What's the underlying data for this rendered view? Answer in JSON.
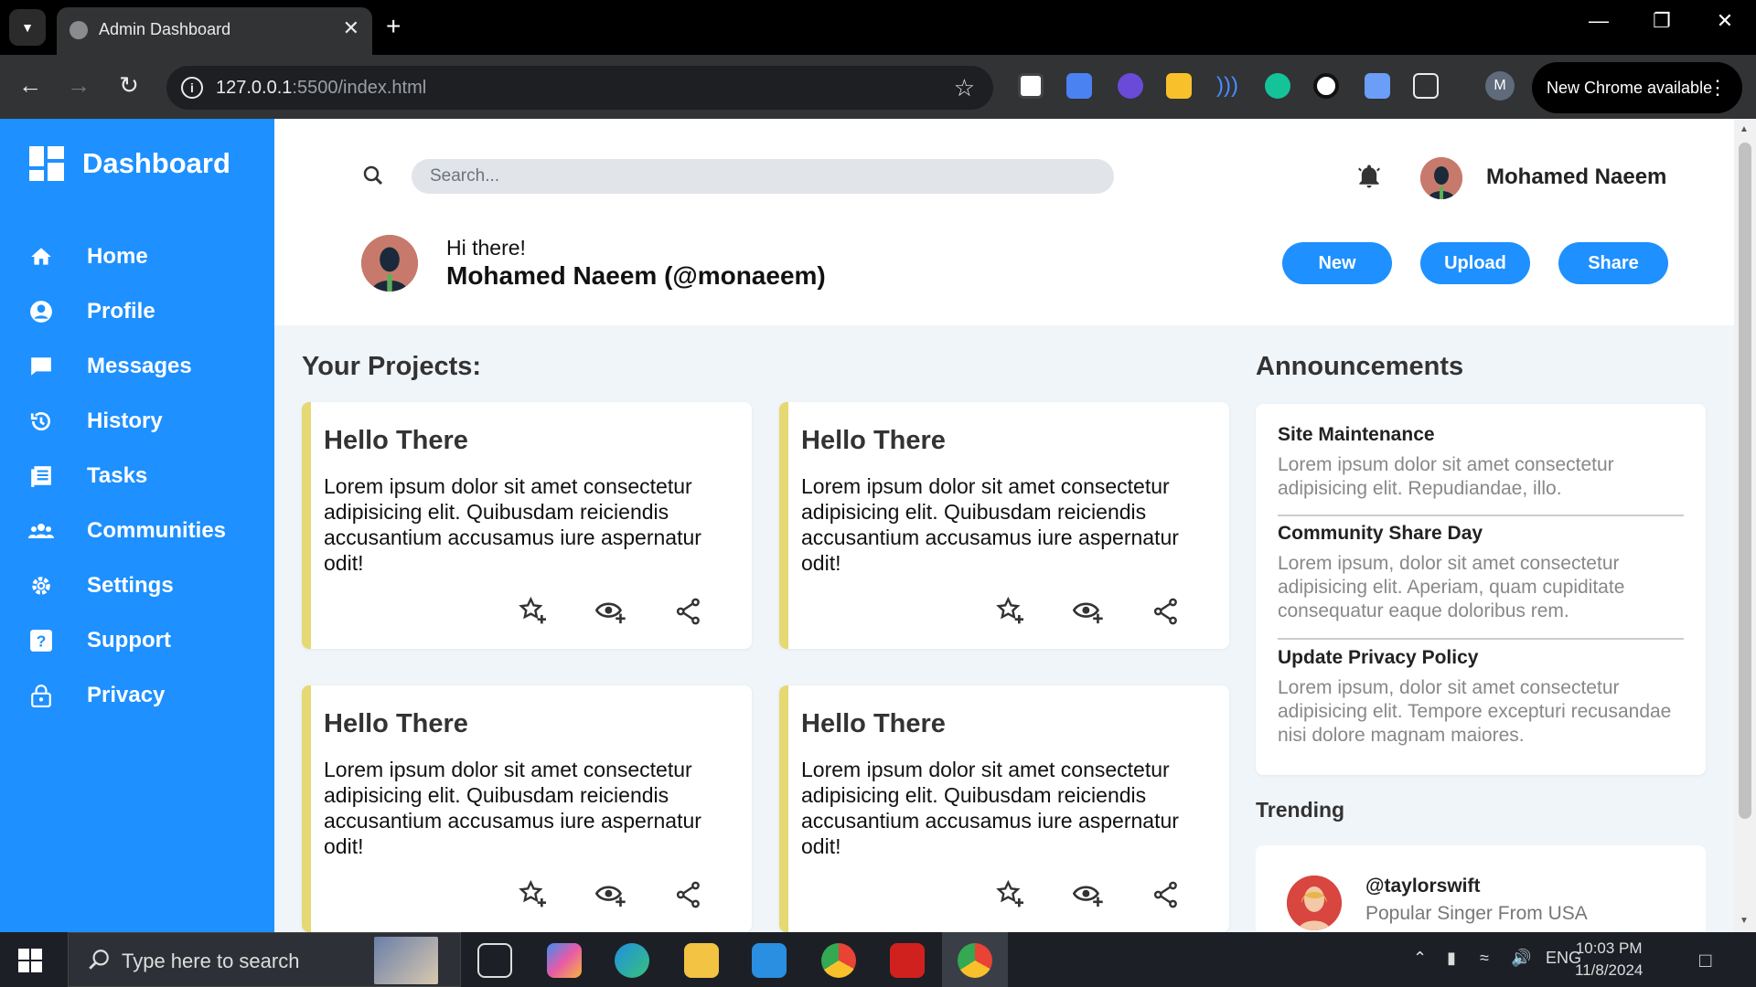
{
  "browser": {
    "tab_title": "Admin Dashboard",
    "url_host": "127.0.0.1",
    "url_path": ":5500/index.html",
    "update_label": "New Chrome available",
    "profile_initial": "M"
  },
  "sidebar": {
    "brand": "Dashboard",
    "items": [
      {
        "label": "Home",
        "icon": "home-icon"
      },
      {
        "label": "Profile",
        "icon": "profile-icon"
      },
      {
        "label": "Messages",
        "icon": "messages-icon"
      },
      {
        "label": "History",
        "icon": "history-icon"
      },
      {
        "label": "Tasks",
        "icon": "tasks-icon"
      },
      {
        "label": "Communities",
        "icon": "communities-icon"
      },
      {
        "label": "Settings",
        "icon": "gear-icon"
      },
      {
        "label": "Support",
        "icon": "help-icon"
      },
      {
        "label": "Privacy",
        "icon": "lock-icon"
      }
    ]
  },
  "header": {
    "search_placeholder": "Search...",
    "username": "Mohamed Naeem",
    "greeting": "Hi there!",
    "full_name": "Mohamed Naeem (@monaeem)",
    "buttons": {
      "new": "New",
      "upload": "Upload",
      "share": "Share"
    }
  },
  "projects": {
    "title": "Your Projects:",
    "cards": [
      {
        "title": "Hello There",
        "text": "Lorem ipsum dolor sit amet consectetur adipisicing elit. Quibusdam reiciendis accusantium accusamus iure aspernatur odit!"
      },
      {
        "title": "Hello There",
        "text": "Lorem ipsum dolor sit amet consectetur adipisicing elit. Quibusdam reiciendis accusantium accusamus iure aspernatur odit!"
      },
      {
        "title": "Hello There",
        "text": "Lorem ipsum dolor sit amet consectetur adipisicing elit. Quibusdam reiciendis accusantium accusamus iure aspernatur odit!"
      },
      {
        "title": "Hello There",
        "text": "Lorem ipsum dolor sit amet consectetur adipisicing elit. Quibusdam reiciendis accusantium accusamus iure aspernatur odit!"
      }
    ]
  },
  "announcements": {
    "title": "Announcements",
    "items": [
      {
        "title": "Site Maintenance",
        "text": "Lorem ipsum dolor sit amet consectetur adipisicing elit. Repudiandae, illo."
      },
      {
        "title": "Community Share Day",
        "text": "Lorem ipsum, dolor sit amet consectetur adipisicing elit. Aperiam, quam cupiditate consequatur eaque doloribus rem."
      },
      {
        "title": "Update Privacy Policy",
        "text": "Lorem ipsum, dolor sit amet consectetur adipisicing elit. Tempore excepturi recusandae nisi dolore magnam maiores."
      }
    ]
  },
  "trending": {
    "title": "Trending",
    "handle": "@taylorswift",
    "description": "Popular Singer From USA"
  },
  "taskbar": {
    "search_placeholder": "Type here to search",
    "language": "ENG",
    "time": "10:03 PM",
    "date": "11/8/2024"
  },
  "colors": {
    "accent": "#1e90ff",
    "card_border": "#e6d873",
    "page_bg": "#f0f5fa"
  }
}
